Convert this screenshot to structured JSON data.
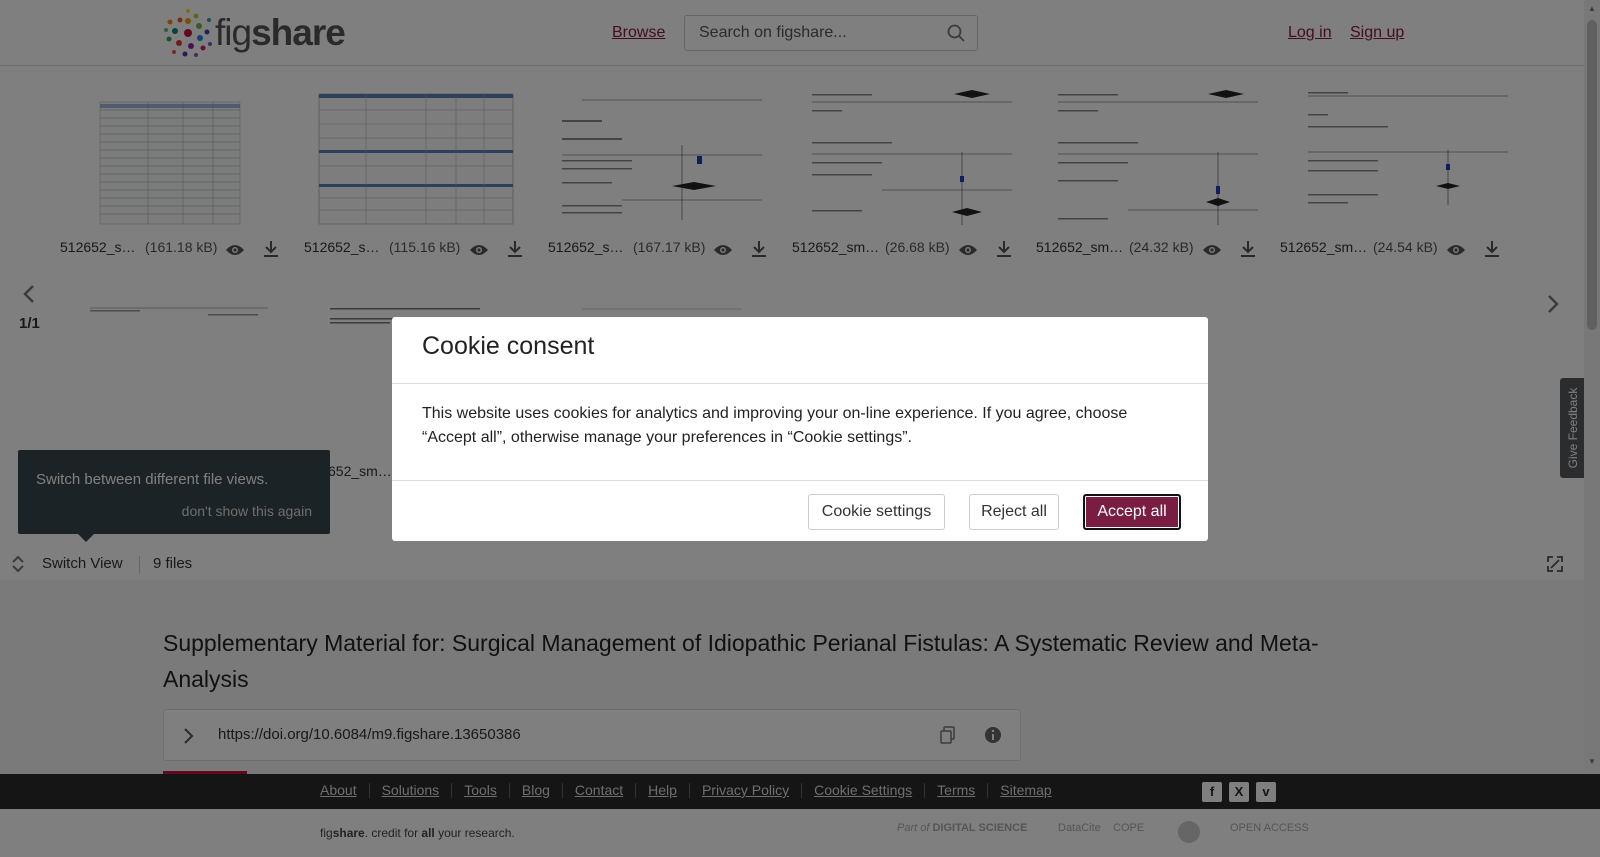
{
  "header": {
    "logo_prefix": "fig",
    "logo_suffix": "share",
    "browse": "Browse",
    "search_placeholder": "Search on figshare...",
    "login": "Log in",
    "signup": "Sign up"
  },
  "gallery": {
    "files": [
      {
        "name": "512652_s…",
        "size": "(161.18 kB)"
      },
      {
        "name": "512652_s…",
        "size": "(115.16 kB)"
      },
      {
        "name": "512652_s…",
        "size": "(167.17 kB)"
      },
      {
        "name": "512652_sm…",
        "size": "(26.68 kB)"
      },
      {
        "name": "512652_sm…",
        "size": "(24.32 kB)"
      },
      {
        "name": "512652_sm…",
        "size": "(24.54 kB)"
      },
      {
        "name": "",
        "size": ""
      },
      {
        "name": "652_sm…",
        "size": ""
      },
      {
        "name": "",
        "size": ""
      }
    ],
    "pager": "1/1"
  },
  "tooltip": {
    "text": "Switch between different file views.",
    "dismiss": "don't show this again"
  },
  "switchbar": {
    "label": "Switch View",
    "files_count": "9 files"
  },
  "item": {
    "title": "Supplementary Material for: Surgical Management of Idiopathic Perianal Fistulas: A Systematic Review and Meta-Analysis",
    "doi": "https://doi.org/10.6084/m9.figshare.13650386"
  },
  "feedback": "Give Feedback",
  "footer": {
    "links": [
      "About",
      "Solutions",
      "Tools",
      "Blog",
      "Contact",
      "Help",
      "Privacy Policy",
      "Cookie Settings",
      "Terms",
      "Sitemap"
    ],
    "tagline_fig": "fig",
    "tagline_share": "share",
    "tagline_mid": ". credit for ",
    "tagline_all": "all",
    "tagline_end": " your research.",
    "part_of": "Part of",
    "digital_science": "DIGITAL SCIENCE",
    "datacite": "DataCite",
    "cope": "COPE",
    "open_access": "OPEN ACCESS"
  },
  "cookie": {
    "title": "Cookie consent",
    "body": "This website uses cookies for analytics and improving your on-line experience. If you agree, choose “Accept all”, otherwise manage your preferences in “Cookie settings”.",
    "settings": "Cookie settings",
    "reject": "Reject all",
    "accept": "Accept all"
  },
  "colors": {
    "brand": "#8b1a3f",
    "accept": "#7a1d43",
    "tooltip": "#37474f",
    "footer": "#2b2b2b"
  }
}
